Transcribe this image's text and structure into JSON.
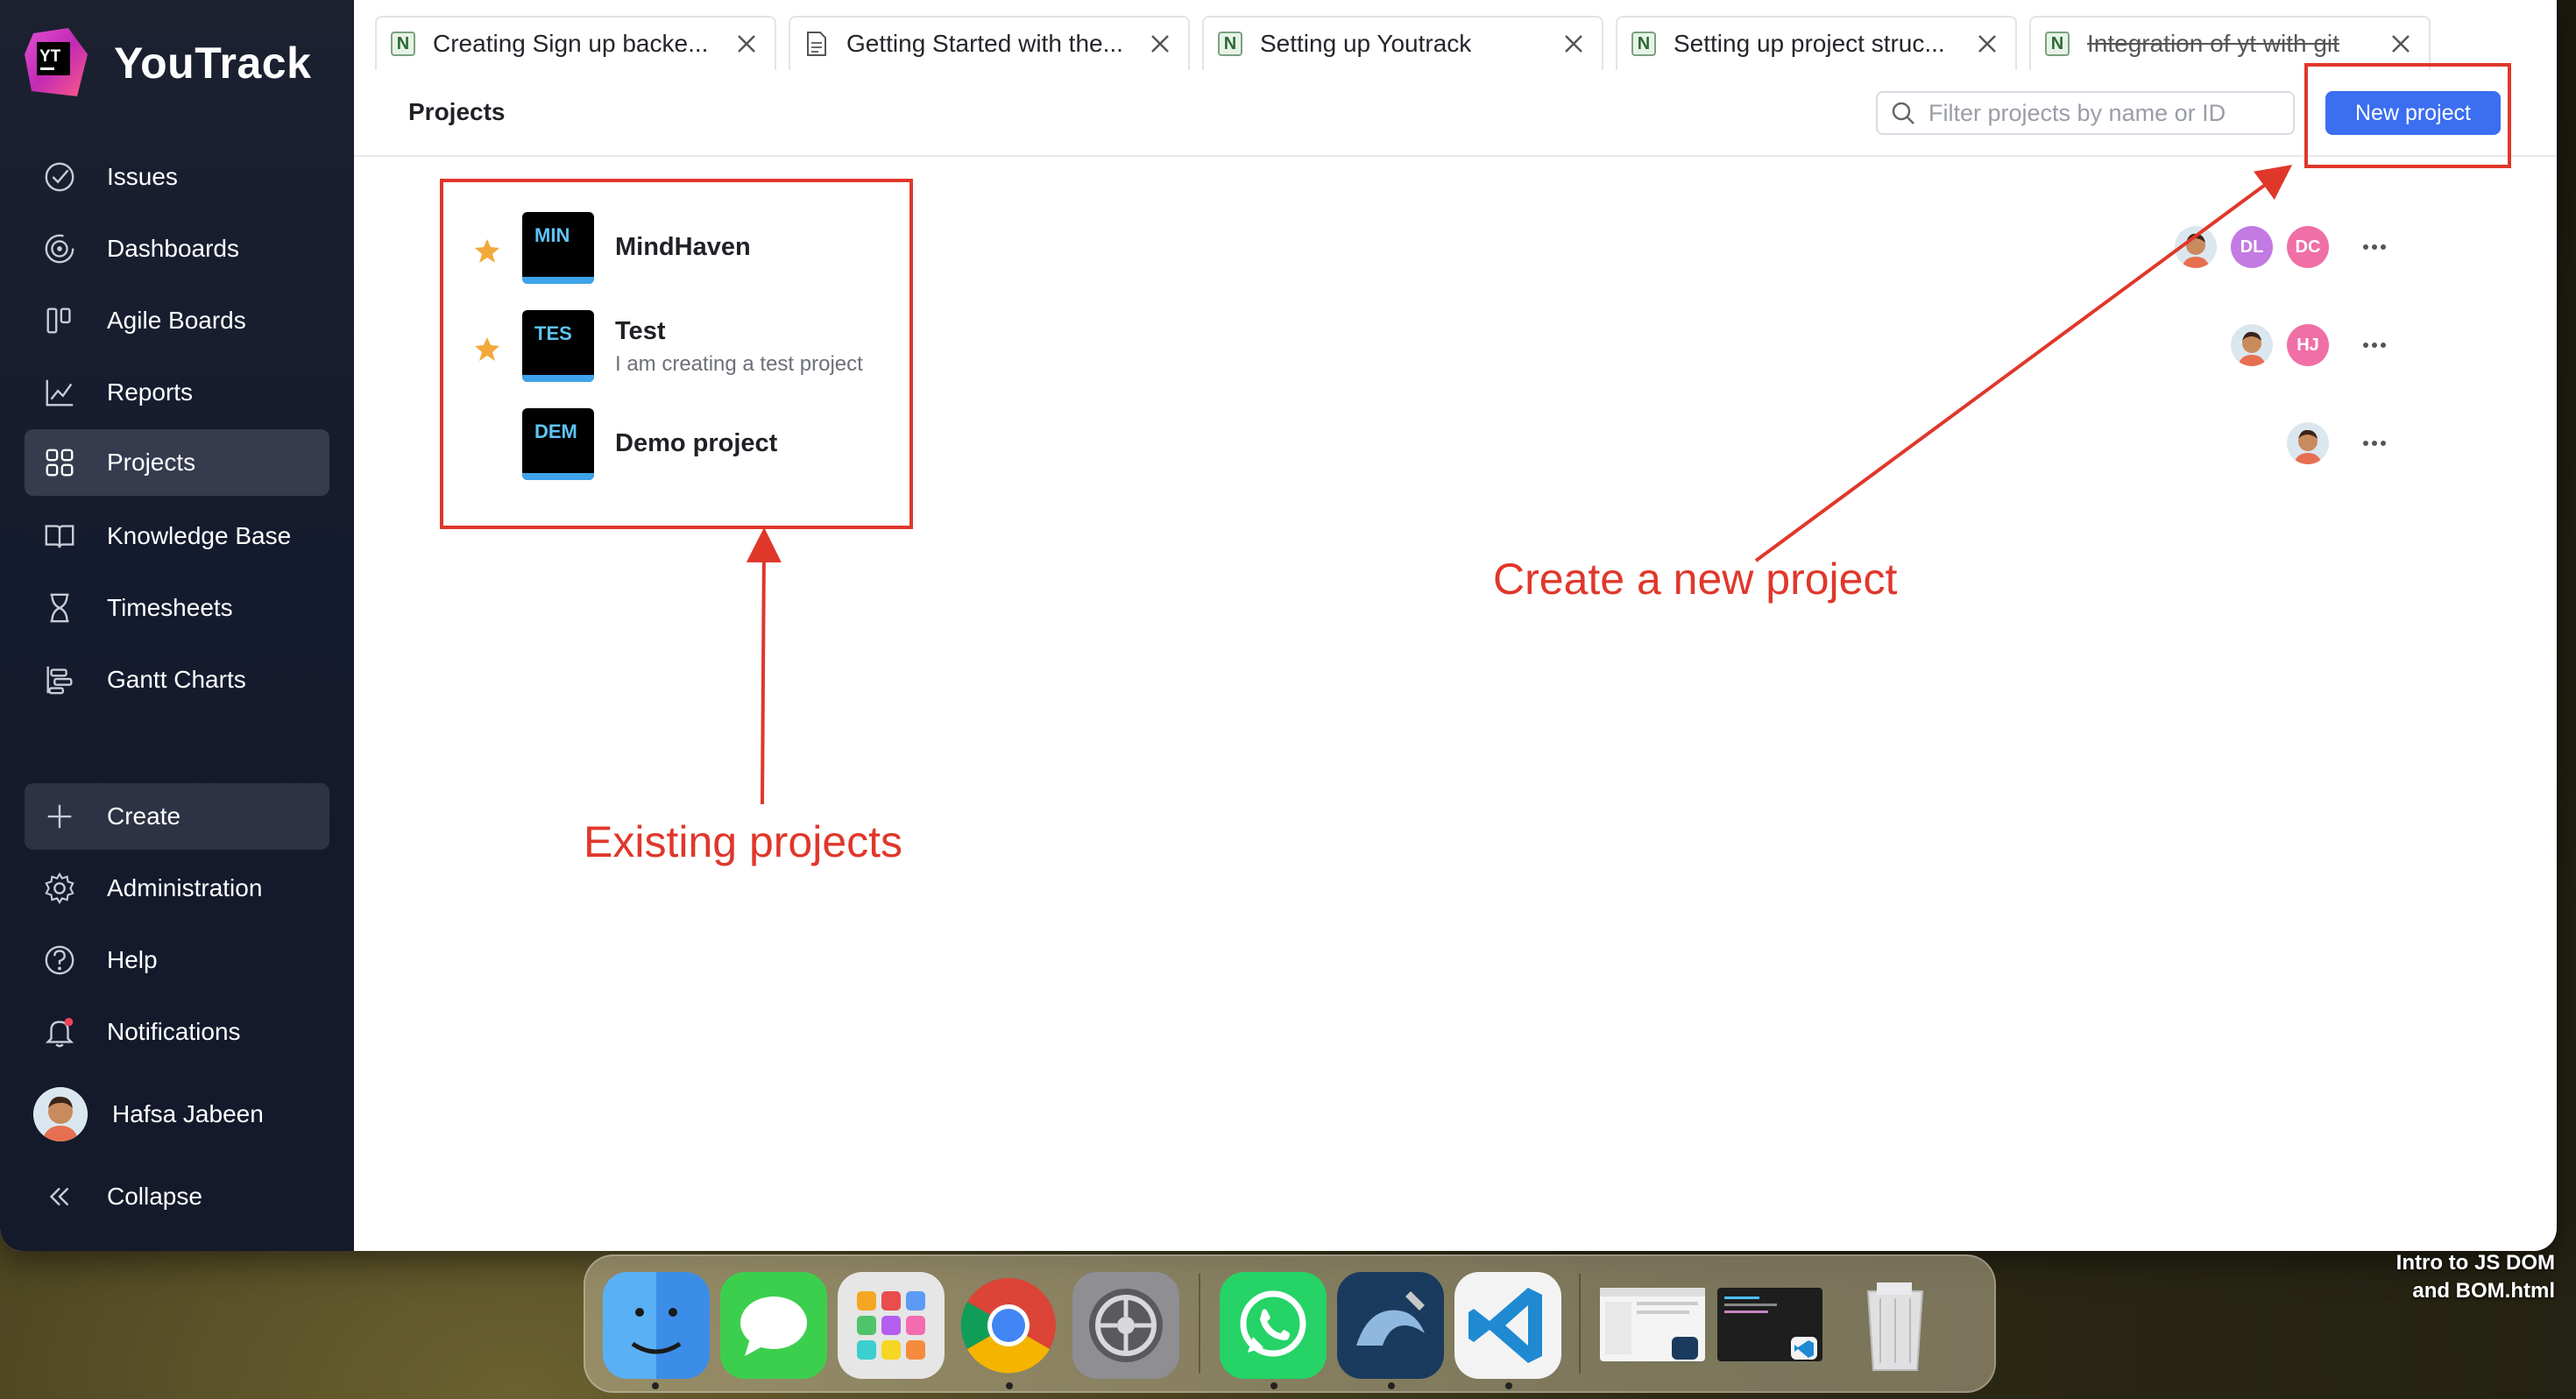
{
  "app": {
    "name": "YouTrack",
    "logo_letters": "YT"
  },
  "sidebar": {
    "items": [
      {
        "label": "Issues",
        "icon": "check-circle-icon"
      },
      {
        "label": "Dashboards",
        "icon": "dashboard-icon"
      },
      {
        "label": "Agile Boards",
        "icon": "board-icon"
      },
      {
        "label": "Reports",
        "icon": "chart-icon"
      },
      {
        "label": "Projects",
        "icon": "grid-icon",
        "active": true
      },
      {
        "label": "Knowledge Base",
        "icon": "book-icon"
      },
      {
        "label": "Timesheets",
        "icon": "hourglass-icon"
      },
      {
        "label": "Gantt Charts",
        "icon": "gantt-icon"
      }
    ],
    "bottom": {
      "create": "Create",
      "administration": "Administration",
      "help": "Help",
      "notifications": "Notifications",
      "user": "Hafsa Jabeen",
      "collapse": "Collapse"
    }
  },
  "tabs": [
    {
      "label": "Creating Sign up backe...",
      "icon": "N"
    },
    {
      "label": "Getting Started with the...",
      "icon": "doc"
    },
    {
      "label": "Setting up Youtrack",
      "icon": "N"
    },
    {
      "label": "Setting up project struc...",
      "icon": "N"
    },
    {
      "label": "Integration of yt with git",
      "icon": "N"
    }
  ],
  "header": {
    "title": "Projects",
    "search_placeholder": "Filter projects by name or ID",
    "new_project": "New project"
  },
  "projects": [
    {
      "key": "MIN",
      "name": "MindHaven",
      "description": "",
      "starred": true,
      "members": [
        "face",
        "DL",
        "DC"
      ]
    },
    {
      "key": "TES",
      "name": "Test",
      "description": "I am creating a test project",
      "starred": true,
      "members": [
        "face",
        "HJ"
      ]
    },
    {
      "key": "DEM",
      "name": "Demo project",
      "description": "",
      "starred": false,
      "members": [
        "face"
      ]
    }
  ],
  "members_colors": {
    "DL": "#c37ae3",
    "DC": "#ef6fa6",
    "HJ": "#ef6fa6"
  },
  "annotations": {
    "existing": "Existing projects",
    "create": "Create a new project",
    "color": "#e0372b"
  },
  "desktop_file": {
    "line1": "Intro to JS DOM",
    "line2": "and BOM.html"
  },
  "colors": {
    "accent": "#3b6ef0",
    "star": "#f2a93b",
    "sidebar": "#151b2e"
  }
}
